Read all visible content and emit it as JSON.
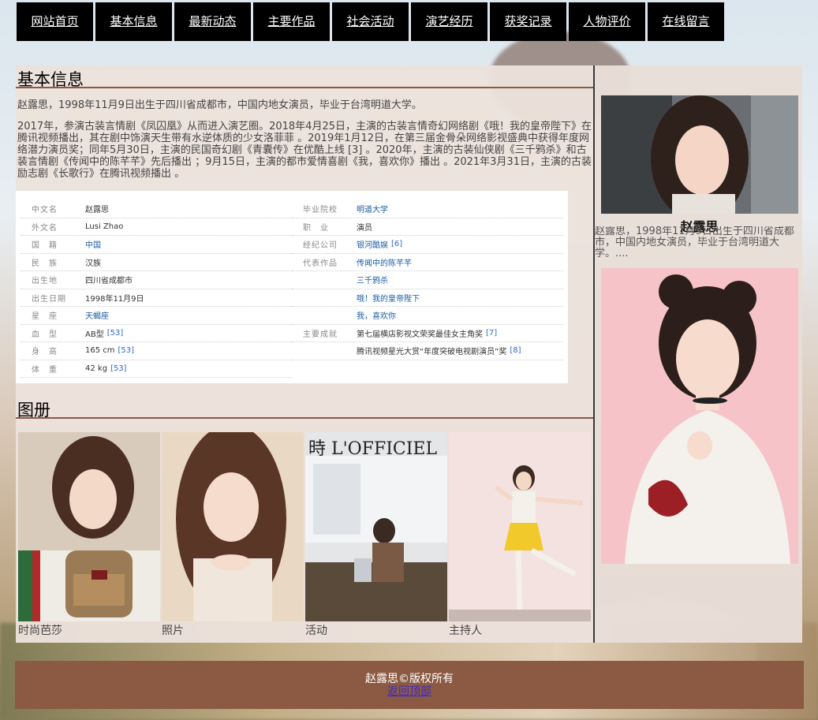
{
  "nav": [
    "网站首页",
    "基本信息",
    "最新动态",
    "主要作品",
    "社会活动",
    "演艺经历",
    "获奖记录",
    "人物评价",
    "在线留言"
  ],
  "main": {
    "title": "基本信息",
    "intro_short": "赵露思，1998年11月9日出生于四川省成都市，中国内地女演员，毕业于台湾明道大学。",
    "intro_long": "2017年，参演古装言情剧《凤囚凰》从而进入演艺圈。2018年4月25日，主演的古装言情奇幻网络剧《哦！我的皇帝陛下》在腾讯视频播出，其在剧中饰演天生带有水逆体质的少女洛菲菲 。2019年1月12日，在第三届金骨朵网络影视盛典中获得年度网络潜力演员奖；同年5月30日，主演的民国奇幻剧《青囊传》在优酷上线 [3] 。2020年，主演的古装仙侠剧《三千鸦杀》和古装言情剧《传闻中的陈芊芊》先后播出 ；9月15日，主演的都市爱情喜剧《我，喜欢你》播出 。2021年3月31日，主演的古装励志剧《长歌行》在腾讯视频播出 。",
    "info_left": [
      {
        "key": "中文名",
        "value": "赵露思",
        "link": false,
        "ref": ""
      },
      {
        "key": "外文名",
        "value": "Lusi Zhao",
        "link": false,
        "ref": ""
      },
      {
        "key": "国　籍",
        "value": "中国",
        "link": true,
        "ref": ""
      },
      {
        "key": "民　族",
        "value": "汉族",
        "link": false,
        "ref": ""
      },
      {
        "key": "出生地",
        "value": "四川省成都市",
        "link": false,
        "ref": ""
      },
      {
        "key": "出生日期",
        "value": "1998年11月9日",
        "link": false,
        "ref": ""
      },
      {
        "key": "星　座",
        "value": "天蝎座",
        "link": true,
        "ref": ""
      },
      {
        "key": "血　型",
        "value": "AB型",
        "link": false,
        "ref": "[53]"
      },
      {
        "key": "身　高",
        "value": "165 cm",
        "link": false,
        "ref": "[53]"
      },
      {
        "key": "体　重",
        "value": "42 kg",
        "link": false,
        "ref": "[53]"
      }
    ],
    "info_right": [
      {
        "key": "毕业院校",
        "value": "明道大学",
        "link": true,
        "ref": ""
      },
      {
        "key": "职　业",
        "value": "演员",
        "link": false,
        "ref": ""
      },
      {
        "key": "经纪公司",
        "value": "银河酷娱",
        "link": true,
        "ref": "[6]"
      },
      {
        "key": "代表作品",
        "value": "传闻中的陈芊芊",
        "link": true,
        "ref": ""
      },
      {
        "key": "",
        "value": "三千鸦杀",
        "link": true,
        "ref": ""
      },
      {
        "key": "",
        "value": "哦！我的皇帝陛下",
        "link": true,
        "ref": ""
      },
      {
        "key": "",
        "value": "我，喜欢你",
        "link": true,
        "ref": ""
      },
      {
        "key": "主要成就",
        "value": "第七届横店影视文荣奖最佳女主角奖",
        "link": false,
        "ref": "[7]"
      },
      {
        "key": "",
        "value": "腾讯视频星光大赏“年度突破电视剧演员”奖",
        "link": false,
        "ref": "[8]"
      }
    ],
    "gallery_title": "图册",
    "gallery": [
      {
        "caption": "时尚芭莎"
      },
      {
        "caption": "照片"
      },
      {
        "caption": "活动"
      },
      {
        "caption": "主持人"
      }
    ]
  },
  "sidebar": {
    "name": "赵露思",
    "text": "赵露思，1998年11月9日出生于四川省成都市，中国内地女演员，毕业于台湾明道大学。...."
  },
  "footer": {
    "copyright": "赵露思©版权所有",
    "back_top": "返回顶部"
  }
}
